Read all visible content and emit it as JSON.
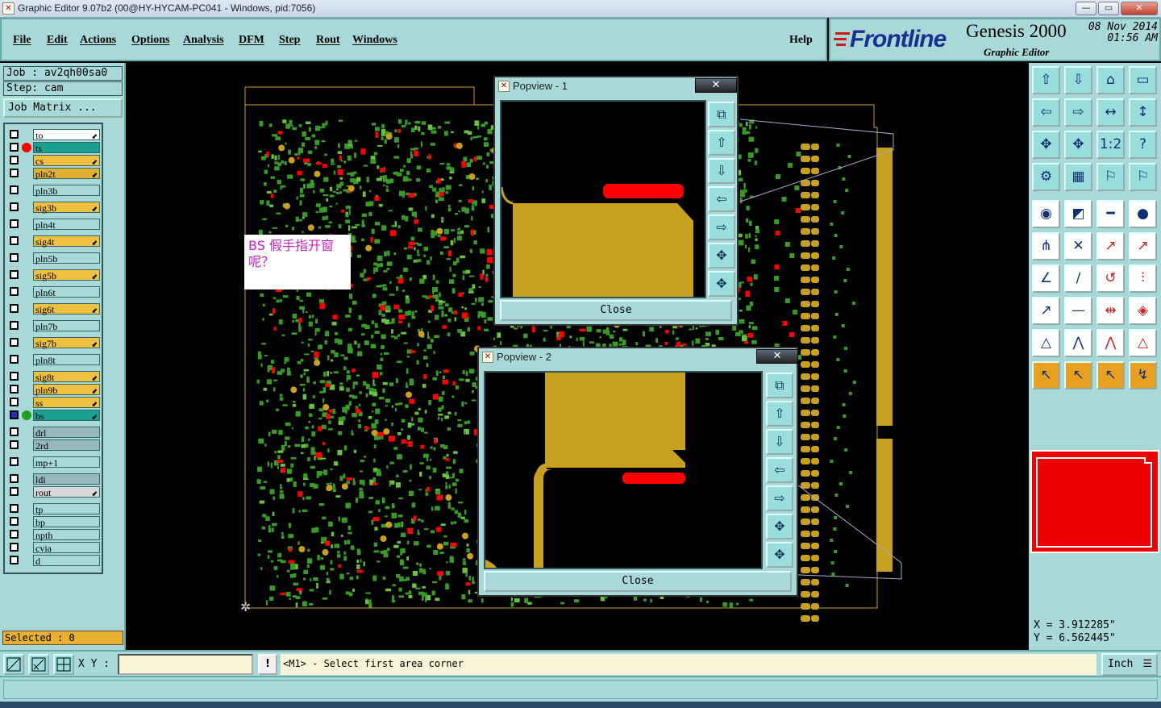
{
  "window": {
    "title": "Graphic Editor 9.07b2 (00@HY-HYCAM-PC041 - Windows, pid:7056)",
    "controls": [
      "—",
      "▭",
      "✕"
    ]
  },
  "menu": {
    "items": [
      "File",
      "Edit",
      "Actions",
      "Options",
      "Analysis",
      "DFM",
      "Step",
      "Rout",
      "Windows"
    ],
    "help": "Help"
  },
  "brand": {
    "logo": "Frontline",
    "product": "Genesis 2000",
    "subtitle": "Graphic Editor",
    "date": "08 Nov 2014",
    "time": "01:56 AM"
  },
  "job": {
    "job_label": "Job : av2qh00sa0",
    "step_label": "Step: cam",
    "matrix_button": "Job Matrix ..."
  },
  "layers": [
    {
      "name": "to",
      "color": "#ffffff",
      "arrow": true,
      "dot": ""
    },
    {
      "name": "ts",
      "color": "#1aa090",
      "arrow": false,
      "dot": "#ff0000"
    },
    {
      "name": "cs",
      "color": "#f0c040",
      "arrow": true,
      "dot": ""
    },
    {
      "name": "pln2t",
      "color": "#e0b030",
      "arrow": true,
      "dot": ""
    },
    {
      "name": "pln3b",
      "color": "#a8d8d8",
      "arrow": false,
      "dot": ""
    },
    {
      "name": "sig3b",
      "color": "#f0c040",
      "arrow": true,
      "dot": ""
    },
    {
      "name": "pln4t",
      "color": "#a8d8d8",
      "arrow": false,
      "dot": ""
    },
    {
      "name": "sig4t",
      "color": "#f0c040",
      "arrow": true,
      "dot": ""
    },
    {
      "name": "pln5b",
      "color": "#a8d8d8",
      "arrow": false,
      "dot": ""
    },
    {
      "name": "sig5b",
      "color": "#f0c040",
      "arrow": true,
      "dot": ""
    },
    {
      "name": "pln6t",
      "color": "#a8d8d8",
      "arrow": false,
      "dot": ""
    },
    {
      "name": "sig6t",
      "color": "#f0c040",
      "arrow": true,
      "dot": ""
    },
    {
      "name": "pln7b",
      "color": "#a8d8d8",
      "arrow": false,
      "dot": ""
    },
    {
      "name": "sig7b",
      "color": "#f0c040",
      "arrow": true,
      "dot": ""
    },
    {
      "name": "pln8t",
      "color": "#a8d8d8",
      "arrow": false,
      "dot": ""
    },
    {
      "name": "sig8t",
      "color": "#f0c040",
      "arrow": true,
      "dot": ""
    },
    {
      "name": "pln9b",
      "color": "#f0c040",
      "arrow": true,
      "dot": ""
    },
    {
      "name": "ss",
      "color": "#f0c040",
      "arrow": true,
      "dot": ""
    },
    {
      "name": "bs",
      "color": "#1aa090",
      "arrow": true,
      "dot": "#20a020"
    },
    {
      "name": "drl",
      "color": "#98b8c0",
      "arrow": false,
      "dot": ""
    },
    {
      "name": "2rd",
      "color": "#98b8c0",
      "arrow": false,
      "dot": ""
    },
    {
      "name": "mp+1",
      "color": "#a8d8d8",
      "arrow": false,
      "dot": ""
    },
    {
      "name": "ldi",
      "color": "#98b8c0",
      "arrow": false,
      "dot": ""
    },
    {
      "name": "rout",
      "color": "#d8d8d8",
      "arrow": true,
      "dot": ""
    },
    {
      "name": "tp",
      "color": "#a8d8d8",
      "arrow": false,
      "dot": ""
    },
    {
      "name": "bp",
      "color": "#a8d8d8",
      "arrow": false,
      "dot": ""
    },
    {
      "name": "npth",
      "color": "#a8d8d8",
      "arrow": false,
      "dot": ""
    },
    {
      "name": "cvia",
      "color": "#a8d8d8",
      "arrow": false,
      "dot": ""
    },
    {
      "name": "d",
      "color": "#a8d8d8",
      "arrow": false,
      "dot": ""
    }
  ],
  "selected_label": "Selected : 0",
  "note": {
    "text": "BS 假手指开窗呢？"
  },
  "popviews": [
    {
      "title": "Popview - 1",
      "close_label": "Close"
    },
    {
      "title": "Popview - 2",
      "close_label": "Close"
    }
  ],
  "coords": {
    "x": "X = 3.912285\"",
    "y": "Y = 6.562445\""
  },
  "bottom": {
    "xy_label": "X Y :",
    "xy_value": "",
    "alert_icon": "!",
    "prompt": "<M1> - Select first area corner",
    "units": "Inch"
  },
  "colors": {
    "panel": "#a8d8d8",
    "copper": "#c8a020",
    "pad_red": "#ff0000",
    "trace_green": "#3a9a28"
  }
}
